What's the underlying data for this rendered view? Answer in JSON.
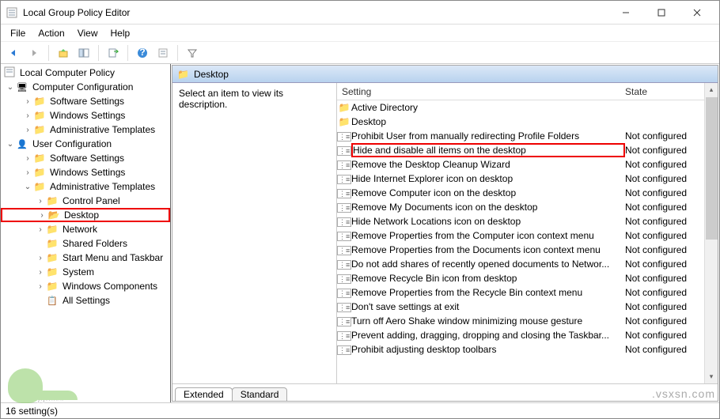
{
  "window": {
    "title": "Local Group Policy Editor"
  },
  "menu": [
    "File",
    "Action",
    "View",
    "Help"
  ],
  "tree": {
    "root": "Local Computer Policy",
    "comp": "Computer Configuration",
    "comp_children": [
      "Software Settings",
      "Windows Settings",
      "Administrative Templates"
    ],
    "user": "User Configuration",
    "user_children": [
      "Software Settings",
      "Windows Settings"
    ],
    "admin": "Administrative Templates",
    "admin_children": [
      "Control Panel",
      "Desktop",
      "Network",
      "Shared Folders",
      "Start Menu and Taskbar",
      "System",
      "Windows Components",
      "All Settings"
    ]
  },
  "crumb": "Desktop",
  "desc": "Select an item to view its description.",
  "headers": {
    "setting": "Setting",
    "state": "State"
  },
  "settings": [
    {
      "label": "Active Directory",
      "type": "folder",
      "state": ""
    },
    {
      "label": "Desktop",
      "type": "folder",
      "state": ""
    },
    {
      "label": "Prohibit User from manually redirecting Profile Folders",
      "type": "policy",
      "state": "Not configured"
    },
    {
      "label": "Hide and disable all items on the desktop",
      "type": "policy",
      "state": "Not configured",
      "highlight": true
    },
    {
      "label": "Remove the Desktop Cleanup Wizard",
      "type": "policy",
      "state": "Not configured"
    },
    {
      "label": "Hide Internet Explorer icon on desktop",
      "type": "policy",
      "state": "Not configured"
    },
    {
      "label": "Remove Computer icon on the desktop",
      "type": "policy",
      "state": "Not configured"
    },
    {
      "label": "Remove My Documents icon on the desktop",
      "type": "policy",
      "state": "Not configured"
    },
    {
      "label": "Hide Network Locations icon on desktop",
      "type": "policy",
      "state": "Not configured"
    },
    {
      "label": "Remove Properties from the Computer icon context menu",
      "type": "policy",
      "state": "Not configured"
    },
    {
      "label": "Remove Properties from the Documents icon context menu",
      "type": "policy",
      "state": "Not configured"
    },
    {
      "label": "Do not add shares of recently opened documents to Networ...",
      "type": "policy",
      "state": "Not configured"
    },
    {
      "label": "Remove Recycle Bin icon from desktop",
      "type": "policy",
      "state": "Not configured"
    },
    {
      "label": "Remove Properties from the Recycle Bin context menu",
      "type": "policy",
      "state": "Not configured"
    },
    {
      "label": "Don't save settings at exit",
      "type": "policy",
      "state": "Not configured"
    },
    {
      "label": "Turn off Aero Shake window minimizing mouse gesture",
      "type": "policy",
      "state": "Not configured"
    },
    {
      "label": "Prevent adding, dragging, dropping and closing the Taskbar...",
      "type": "policy",
      "state": "Not configured"
    },
    {
      "label": "Prohibit adjusting desktop toolbars",
      "type": "policy",
      "state": "Not configured"
    }
  ],
  "tabs": {
    "extended": "Extended",
    "standard": "Standard"
  },
  "status": "16 setting(s)",
  "wm1": "ppuals",
  "wm2": ".vsxsn.com"
}
